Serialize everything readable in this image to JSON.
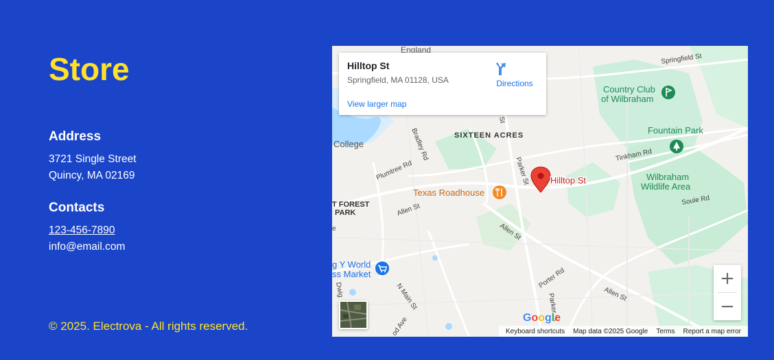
{
  "store": {
    "title": "Store",
    "address_heading": "Address",
    "address_line1": "3721 Single Street",
    "address_line2": "Quincy, MA 02169",
    "contacts_heading": "Contacts",
    "phone": "123-456-7890",
    "email": "info@email.com",
    "copyright": "© 2025. Electrova - All rights reserved."
  },
  "colors": {
    "background": "#1b45c9",
    "accent": "#ffe12a"
  },
  "map": {
    "place_name": "Hilltop St",
    "place_address": "Springfield, MA 01128, USA",
    "directions_label": "Directions",
    "view_larger_label": "View larger map",
    "marker_label": "Hilltop St",
    "zoom_in_label": "+",
    "zoom_out_label": "−",
    "attribution": {
      "shortcuts": "Keyboard shortcuts",
      "map_data": "Map data ©2025 Google",
      "terms": "Terms",
      "report": "Report a map error"
    },
    "labels": {
      "england": "England",
      "springfield_st": "Springfield St",
      "country_club": "Country Club",
      "of_wilbraham": "of Wilbraham",
      "fountain_park": "Fountain Park",
      "tinkham_rd": "Tinkham Rd",
      "sixteen_acres": "SIXTEEN ACRES",
      "college": "College",
      "bradley_rd": "Bradley Rd",
      "plumtree_rd": "Plumtree Rd",
      "parker_st": "Parker St",
      "st": "St",
      "wilbraham_wildlife1": "Wilbraham",
      "wilbraham_wildlife2": "Wildlife Area",
      "soule_rd": "Soule Rd",
      "texas_roadhouse": "Texas Roadhouse",
      "t_forest": "T FOREST",
      "park": "PARK",
      "allen_st1": "Allen St",
      "allen_st2": "Allen St",
      "allen_st3": "Allen St",
      "porter_rd": "Porter Rd",
      "parker_st2": "Parker St",
      "world_market1": "g Y World",
      "world_market2": "ss Market",
      "n_main_st": "N Main St",
      "dwig": "Dwig",
      "od_ave": "od Ave",
      "e": "e"
    },
    "icons": {
      "directions": "directions-arrow-icon",
      "pin": "location-pin-icon",
      "restaurant": "restaurant-icon",
      "golf": "golf-icon",
      "park": "park-tree-icon",
      "shopping": "shopping-cart-icon"
    }
  }
}
